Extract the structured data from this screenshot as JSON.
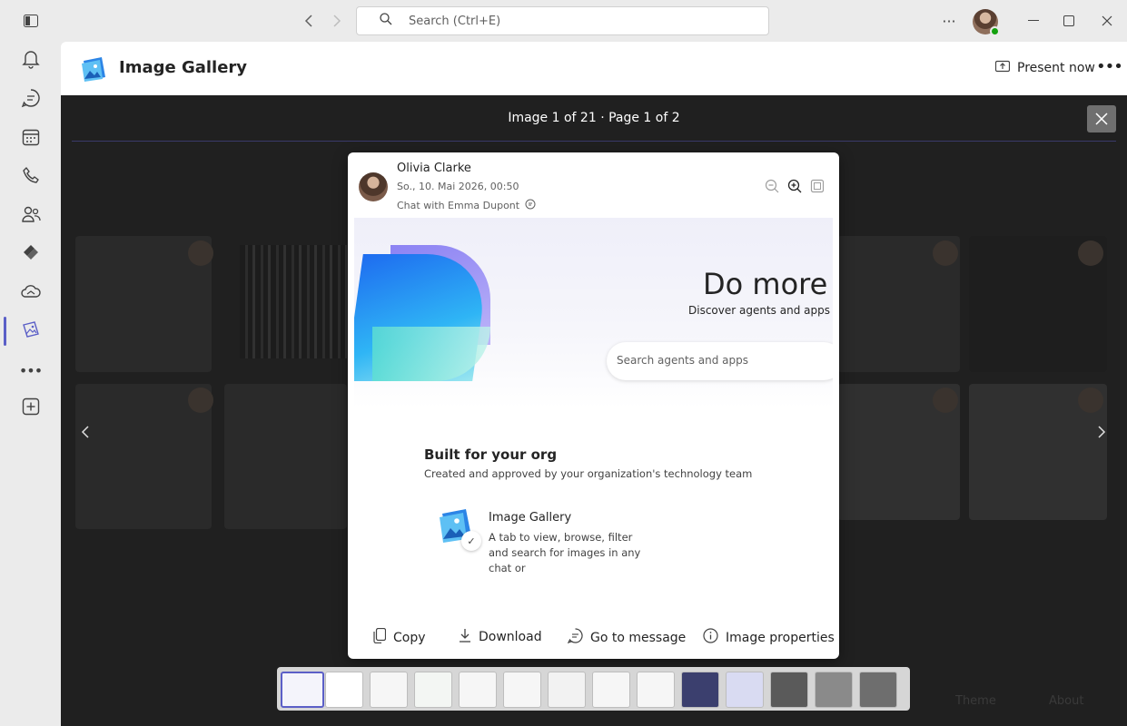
{
  "titlebar": {
    "search_placeholder": "Search (Ctrl+E)"
  },
  "rail": {
    "items": [
      {
        "icon": "bell-icon",
        "name": "activity"
      },
      {
        "icon": "chat-icon",
        "name": "chat"
      },
      {
        "icon": "calendar-icon",
        "name": "calendar"
      },
      {
        "icon": "phone-icon",
        "name": "calls"
      },
      {
        "icon": "people-icon",
        "name": "people"
      },
      {
        "icon": "viva-icon",
        "name": "viva"
      },
      {
        "icon": "cloud-icon",
        "name": "onedrive"
      },
      {
        "icon": "image-gallery-icon",
        "name": "image-gallery",
        "active": true
      },
      {
        "icon": "more-icon",
        "name": "more-apps"
      },
      {
        "icon": "add-apps-icon",
        "name": "apps"
      }
    ]
  },
  "app": {
    "title": "Image Gallery",
    "present_label": "Present now"
  },
  "viewer": {
    "counter": "Image 1 of 21 · Page 1 of 2"
  },
  "modal": {
    "sender": "Olivia Clarke",
    "date": "So., 10. Mai 2026, 00:50",
    "chat_with": "Chat with Emma Dupont",
    "preview": {
      "hero_title": "Do more",
      "hero_subtitle": "Discover agents and apps that",
      "search_placeholder": "Search agents and apps",
      "section_title": "Built for your org",
      "section_subtitle": "Created and approved by your organization's technology team",
      "card_title": "Image Gallery",
      "card_description": "A tab to view, browse, filter and search for images in any chat or"
    },
    "actions": {
      "copy": "Copy",
      "download": "Download",
      "go_to_message": "Go to message",
      "image_properties": "Image properties"
    }
  },
  "background": {
    "theme": "Theme",
    "about": "About"
  },
  "colors": {
    "accent": "#5b5fc7",
    "overlay": "#202020",
    "presence": "#13a10e"
  },
  "thumbnails_count": 14
}
